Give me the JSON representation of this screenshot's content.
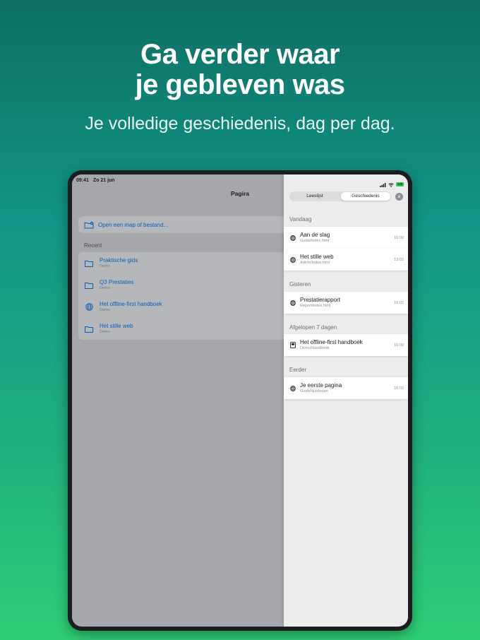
{
  "header": {
    "headline_line1": "Ga verder waar",
    "headline_line2": "je gebleven was",
    "subhead": "Je volledige geschiedenis, dag per dag."
  },
  "status_bar": {
    "time": "09:41",
    "date": "Zo 21 jun",
    "battery": "100"
  },
  "app": {
    "title": "Pagira"
  },
  "open_action": {
    "label": "Open een map of bestand..."
  },
  "recent": {
    "label": "Recent",
    "items": [
      {
        "title": "Praktische gids",
        "subtitle": "Demo",
        "icon": "folder-icon"
      },
      {
        "title": "Q3 Prestaties",
        "subtitle": "Demo",
        "icon": "folder-icon"
      },
      {
        "title": "Het offline-first handboek",
        "subtitle": "Demo",
        "icon": "globe-icon"
      },
      {
        "title": "Het stille web",
        "subtitle": "Demo",
        "icon": "folder-icon"
      }
    ]
  },
  "panel": {
    "tabs": [
      {
        "label": "Leeslijst",
        "active": false
      },
      {
        "label": "Geschiedenis",
        "active": true
      }
    ],
    "close_icon": "close-icon",
    "sections": [
      {
        "label": "Vandaag",
        "items": [
          {
            "title": "Aan de slag",
            "path": "Guide/index.html",
            "time": "16:02",
            "icon": "globe-icon"
          },
          {
            "title": "Het stille web",
            "path": "Article/index.html",
            "time": "13:02",
            "icon": "globe-icon"
          }
        ]
      },
      {
        "label": "Gisteren",
        "items": [
          {
            "title": "Prestatierapport",
            "path": "Report/index.html",
            "time": "16:02",
            "icon": "globe-icon"
          }
        ]
      },
      {
        "label": "Afgelopen 7 dagen",
        "items": [
          {
            "title": "Het offline-first handboek",
            "path": "Demo/Handbook",
            "time": "16:02",
            "icon": "book-icon"
          }
        ]
      },
      {
        "label": "Eerder",
        "items": [
          {
            "title": "Je eerste pagina",
            "path": "Guide/quickstart",
            "time": "16:02",
            "icon": "globe-icon"
          }
        ]
      }
    ]
  },
  "colors": {
    "accent": "#0b5fb4",
    "background_top": "#0e6f64",
    "background_bottom": "#2fcf76",
    "battery": "#34c759"
  }
}
